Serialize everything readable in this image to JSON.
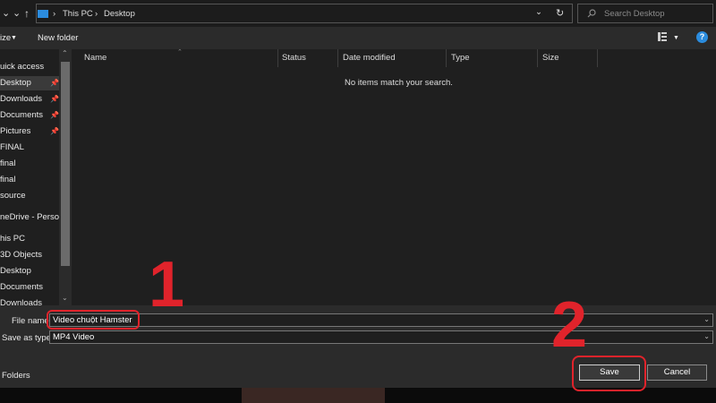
{
  "address": {
    "crumbs": [
      "This PC",
      "Desktop"
    ]
  },
  "search": {
    "placeholder": "Search Desktop"
  },
  "toolbar": {
    "organize_label": "ize",
    "new_folder_label": "New folder",
    "help_label": "?"
  },
  "sidebar": {
    "items": [
      {
        "label": "uick access",
        "pinned": false
      },
      {
        "label": "Desktop",
        "pinned": true
      },
      {
        "label": "Downloads",
        "pinned": true
      },
      {
        "label": "Documents",
        "pinned": true
      },
      {
        "label": "Pictures",
        "pinned": true
      },
      {
        "label": "FINAL",
        "pinned": false
      },
      {
        "label": "final",
        "pinned": false
      },
      {
        "label": "final",
        "pinned": false
      },
      {
        "label": "source",
        "pinned": false
      },
      {
        "label": "neDrive - Person",
        "pinned": false
      },
      {
        "label": "his PC",
        "pinned": false
      },
      {
        "label": "3D Objects",
        "pinned": false
      },
      {
        "label": "Desktop",
        "pinned": false
      },
      {
        "label": "Documents",
        "pinned": false
      },
      {
        "label": "Downloads",
        "pinned": false
      }
    ]
  },
  "columns": [
    "Name",
    "Status",
    "Date modified",
    "Type",
    "Size"
  ],
  "empty_message": "No items match your search.",
  "file_name": {
    "label": "File name:",
    "value": "Video chuột Hamster"
  },
  "save_as_type": {
    "label": "Save as type:",
    "value": "MP4 Video"
  },
  "folders_toggle": {
    "label": "Folders"
  },
  "buttons": {
    "save": "Save",
    "cancel": "Cancel"
  },
  "annotations": {
    "step1": "1",
    "step2": "2"
  },
  "colors": {
    "accent": "#2b8cde",
    "annotation": "#e0232b"
  }
}
